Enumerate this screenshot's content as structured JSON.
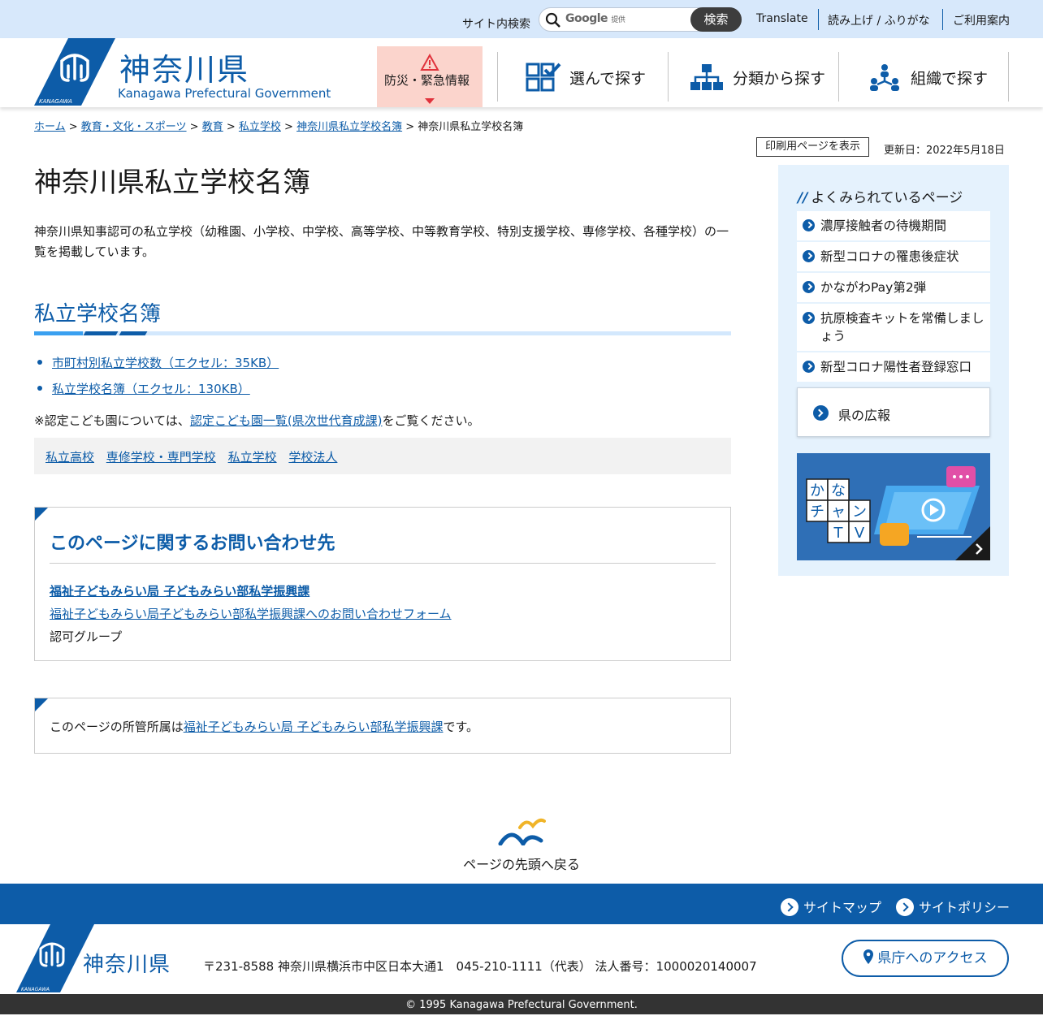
{
  "topbar": {
    "search_label": "サイト内検索",
    "google_label": "Google",
    "google_sub": "提供",
    "search_button": "検索",
    "translate": "Translate",
    "yomiage": "読み上げ / ふりがな",
    "guide": "ご利用案内"
  },
  "header": {
    "logo_jp": "神奈川県",
    "logo_en": "Kanagawa Prefectural Government",
    "logo_small": "KANAGAWA",
    "emergency": "防災・緊急情報",
    "nav": [
      "選んで探す",
      "分類から探す",
      "組織で探す"
    ]
  },
  "breadcrumb": {
    "items": [
      "ホーム",
      "教育・文化・スポーツ",
      "教育",
      "私立学校",
      "神奈川県私立学校名簿"
    ],
    "current": "神奈川県私立学校名簿"
  },
  "print_button": "印刷用ページを表示",
  "updated": "更新日：2022年5月18日",
  "main": {
    "title": "神奈川県私立学校名簿",
    "intro": "神奈川県知事認可の私立学校（幼稚園、小学校、中学校、高等学校、中等教育学校、特別支援学校、専修学校、各種学校）の一覧を掲載しています。",
    "section_title": "私立学校名簿",
    "downloads": [
      "市町村別私立学校数（エクセル：35KB）",
      "私立学校名簿（エクセル：130KB）"
    ],
    "note_prefix": "※認定こども園については、",
    "note_link": "認定こども園一覧(県次世代育成課)",
    "note_suffix": "をご覧ください。",
    "tags": [
      "私立高校",
      "専修学校・専門学校",
      "私立学校",
      "学校法人"
    ]
  },
  "contact": {
    "title": "このページに関するお問い合わせ先",
    "dept": "福祉子どもみらい局 子どもみらい部私学振興課",
    "form": "福祉子どもみらい局子どもみらい部私学振興課へのお問い合わせフォーム",
    "group": "認可グループ"
  },
  "owner": {
    "prefix": "このページの所管所属は",
    "link": "福祉子どもみらい局 子どもみらい部私学振興課",
    "suffix": "です。"
  },
  "sidebar": {
    "popular_title": "よくみられているページ",
    "popular": [
      "濃厚接触者の待機期間",
      "新型コロナの罹患後症状",
      "かながわPay第2弾",
      "抗原検査キットを常備しましょう",
      "新型コロナ陽性者登録窓口"
    ],
    "koho": "県の広報",
    "tv_chars": [
      "か",
      "な",
      "チ",
      "ャ",
      "ン",
      "T",
      "V"
    ]
  },
  "to_top": "ページの先頭へ戻る",
  "footer": {
    "sitemap": "サイトマップ",
    "policy": "サイトポリシー",
    "logo": "神奈川県",
    "address": "〒231-8588 神奈川県横浜市中区日本大通1　045-210-1111（代表）  法人番号：1000020140007",
    "access": "県庁へのアクセス",
    "copyright": "© 1995 Kanagawa Prefectural Government."
  },
  "colors": {
    "brand": "#0d5ca8",
    "topbar": "#d7e8fb",
    "emergency": "#fbd4cc"
  }
}
